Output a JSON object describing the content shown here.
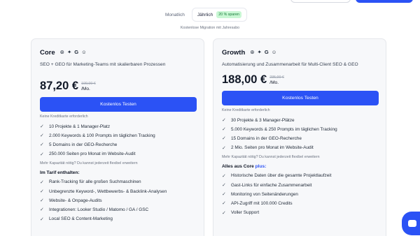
{
  "billing": {
    "monthly_label": "Monatlich",
    "yearly_label": "Jährlich",
    "save_badge": "20 % sparen",
    "migration_note": "Kostenlose Migration mit Jahresabo"
  },
  "plans": [
    {
      "name": "Core",
      "icons": [
        "openai-icon",
        "sparkle-icon",
        "google-icon",
        "robot-icon"
      ],
      "description": "SEO + GEO für Marketing-Teams mit skalierbaren Prozessen",
      "price": "87,20 €",
      "old_price": "109,00 €",
      "period": "/Mo.",
      "cta": "Kostenlos Testen",
      "no_credit_card": "Keine Kreditkarte erforderlich",
      "features": [
        "10 Projekte & 1 Manager-Platz",
        "2.000 Keywords & 100 Prompts im täglichen Tracking",
        "5 Domains in der GEO-Recherche",
        "250.000 Seiten pro Monat im Website-Audit"
      ],
      "more_capacity": "Mehr Kapazität nötig? Du kannst jederzeit flexibel erweitern",
      "included_title": "Im Tarif enthalten:",
      "included_plus": "",
      "included": [
        "Rank-Tracking für alle großen Suchmaschinen",
        "Unbegrenzte Keyword-, Wettbewerbs- & Backlink-Analysen",
        "Website- & Onpage-Audits",
        "Integrationen: Looker Studio / Matomo / GA / GSC",
        "Local SEO & Content-Marketing"
      ]
    },
    {
      "name": "Growth",
      "icons": [
        "openai-icon",
        "sparkle-icon",
        "google-icon",
        "robot-icon"
      ],
      "description": "Automatisierung und Zusammenarbeit für Multi-Client SEO & GEO",
      "price": "188,00 €",
      "old_price": "235,00 €",
      "period": "/Mo.",
      "cta": "Kostenlos Testen",
      "no_credit_card": "Keine Kreditkarte erforderlich",
      "features": [
        "30 Projekte & 3 Manager-Plätze",
        "5.000 Keywords & 250 Prompts im täglichen Tracking",
        "15 Domains in der GEO-Recherche",
        "2 Mio. Seiten pro Monat im Website-Audit"
      ],
      "more_capacity": "Mehr Kapazität nötig? Du kannst jederzeit flexibel erweitern",
      "included_title": "Alles aus Core ",
      "included_plus": "plus:",
      "included": [
        "Historische Daten über die gesamte Projektlaufzeit",
        "Gast-Links für einfache Zusammenarbeit",
        "Monitoring von Seitenänderungen",
        "API-Zugriff mit 100.000 Credits",
        "Voller Support"
      ]
    }
  ]
}
